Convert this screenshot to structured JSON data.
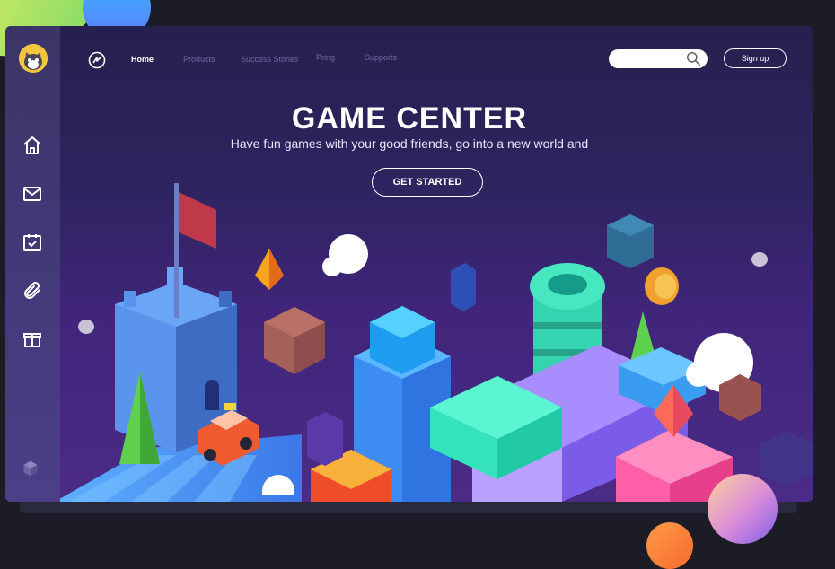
{
  "header": {
    "nav": [
      {
        "label": "Home",
        "active": true
      },
      {
        "label": "Products",
        "active": false
      },
      {
        "label": "Success Stories",
        "active": false
      },
      {
        "label": "Pring",
        "active": false
      },
      {
        "label": "Supports",
        "active": false
      }
    ],
    "search": {
      "placeholder": "",
      "value": ""
    },
    "signup_label": "Sign up"
  },
  "hero": {
    "title": "GAME CENTER",
    "subtitle": "Have fun games with your good friends, go into a new world and",
    "cta_label": "GET STARTED"
  },
  "sidebar": {
    "items": [
      {
        "icon": "home-icon"
      },
      {
        "icon": "mail-icon"
      },
      {
        "icon": "calendar-check-icon"
      },
      {
        "icon": "paperclip-icon"
      },
      {
        "icon": "gift-icon"
      },
      {
        "icon": "cube-icon"
      }
    ]
  },
  "colors": {
    "background": "#1c1c26",
    "window_top": "#26204e",
    "window_bottom": "#4b2b86",
    "sidebar": "#3a3566",
    "accent_blue": "#3fa0ff",
    "accent_pink": "#ff4fa0",
    "accent_teal": "#32e0b8"
  }
}
